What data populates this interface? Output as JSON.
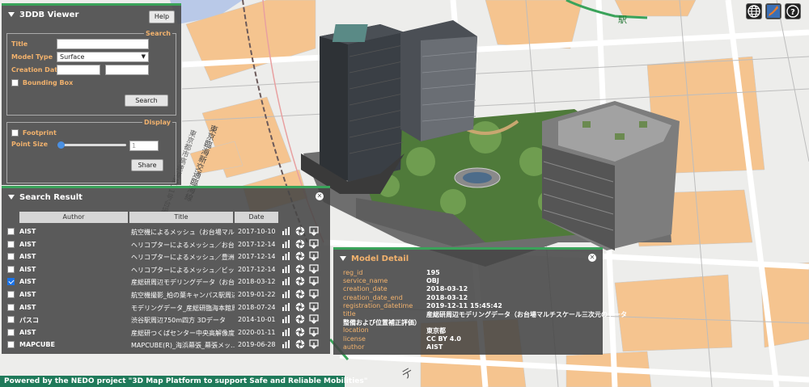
{
  "viewer": {
    "title": "3DDB Viewer",
    "help_label": "Help",
    "search_legend": "Search",
    "title_label": "Title",
    "title_value": "",
    "model_type_label": "Model Type",
    "model_type_value": "Surface",
    "creation_date_label": "Creation Date",
    "bounding_box_label": "Bounding Box",
    "search_button": "Search",
    "display_legend": "Display",
    "footprint_label": "Footprint",
    "point_size_label": "Point Size",
    "point_size_value": "1",
    "share_button": "Share"
  },
  "results": {
    "title": "Search Result",
    "headers": {
      "author": "Author",
      "title": "Title",
      "date": "Date"
    },
    "rows": [
      {
        "author": "AIST",
        "title": "航空機によるメッシュ（お台場マルチ…",
        "date": "2017-10-10",
        "checked": false
      },
      {
        "author": "AIST",
        "title": "ヘリコプターによるメッシュ／お台場…",
        "date": "2017-12-14",
        "checked": false
      },
      {
        "author": "AIST",
        "title": "ヘリコプターによるメッシュ／豊洲（…",
        "date": "2017-12-14",
        "checked": false
      },
      {
        "author": "AIST",
        "title": "ヘリコプターによるメッシュ／ビッグ…",
        "date": "2017-12-14",
        "checked": false
      },
      {
        "author": "AIST",
        "title": "産総研周辺モデリングデータ（お台場…",
        "date": "2018-03-12",
        "checked": true
      },
      {
        "author": "AIST",
        "title": "航空機撮影_柏の葉キャンパス駅周辺",
        "date": "2019-01-22",
        "checked": false
      },
      {
        "author": "AIST",
        "title": "モデリングデータ_産総研臨海本館周辺",
        "date": "2018-07-24",
        "checked": false
      },
      {
        "author": "パスコ",
        "title": "渋谷駅周辺750m四方 3Dデータ",
        "date": "2014-10-01",
        "checked": false
      },
      {
        "author": "AIST",
        "title": "産総研つくばセンター中央高解像度ド…",
        "date": "2020-01-11",
        "checked": false
      },
      {
        "author": "MAPCUBE",
        "title": "MAPCUBE(R)_海浜幕張_幕張メッ…",
        "date": "2019-06-28",
        "checked": false
      }
    ]
  },
  "detail": {
    "title": "Model Detail",
    "fields": [
      {
        "label": "reg_id",
        "value": "195"
      },
      {
        "label": "service_name",
        "value": "OBJ"
      },
      {
        "label": "creation_date",
        "value": "2018-03-12"
      },
      {
        "label": "creation_date_end",
        "value": "2018-03-12"
      },
      {
        "label": "registration_datetime",
        "value": "2019-12-11 15:45:42"
      },
      {
        "label": "title",
        "value": "産総研周辺モデリングデータ（お台場マルチスケール三次元のデータ"
      },
      {
        "label": "",
        "value": "整備および位置補正評価）"
      },
      {
        "label": "location",
        "value": "東京都"
      },
      {
        "label": "license",
        "value": "CC BY 4.0"
      },
      {
        "label": "author",
        "value": "AIST"
      }
    ]
  },
  "map_labels": {
    "station": "駅",
    "road_vertical": "東京臨海新交通臨海線",
    "road_vertical2": "東京都市高速道路11号台場線",
    "road_label": "テ"
  },
  "footer": "Powered by the NEDO project \"3D Map Platform to support Safe and Reliable Mobilities\"",
  "colors": {
    "panel_accent": "#3aa35a",
    "label_orange": "#f2b26d",
    "footer_green": "#1f7a5a",
    "map_orange": "#f5c48f"
  },
  "icons": [
    "globe-icon",
    "japan-map-icon",
    "help-icon",
    "chart-icon",
    "aperture-icon",
    "download-icon"
  ]
}
